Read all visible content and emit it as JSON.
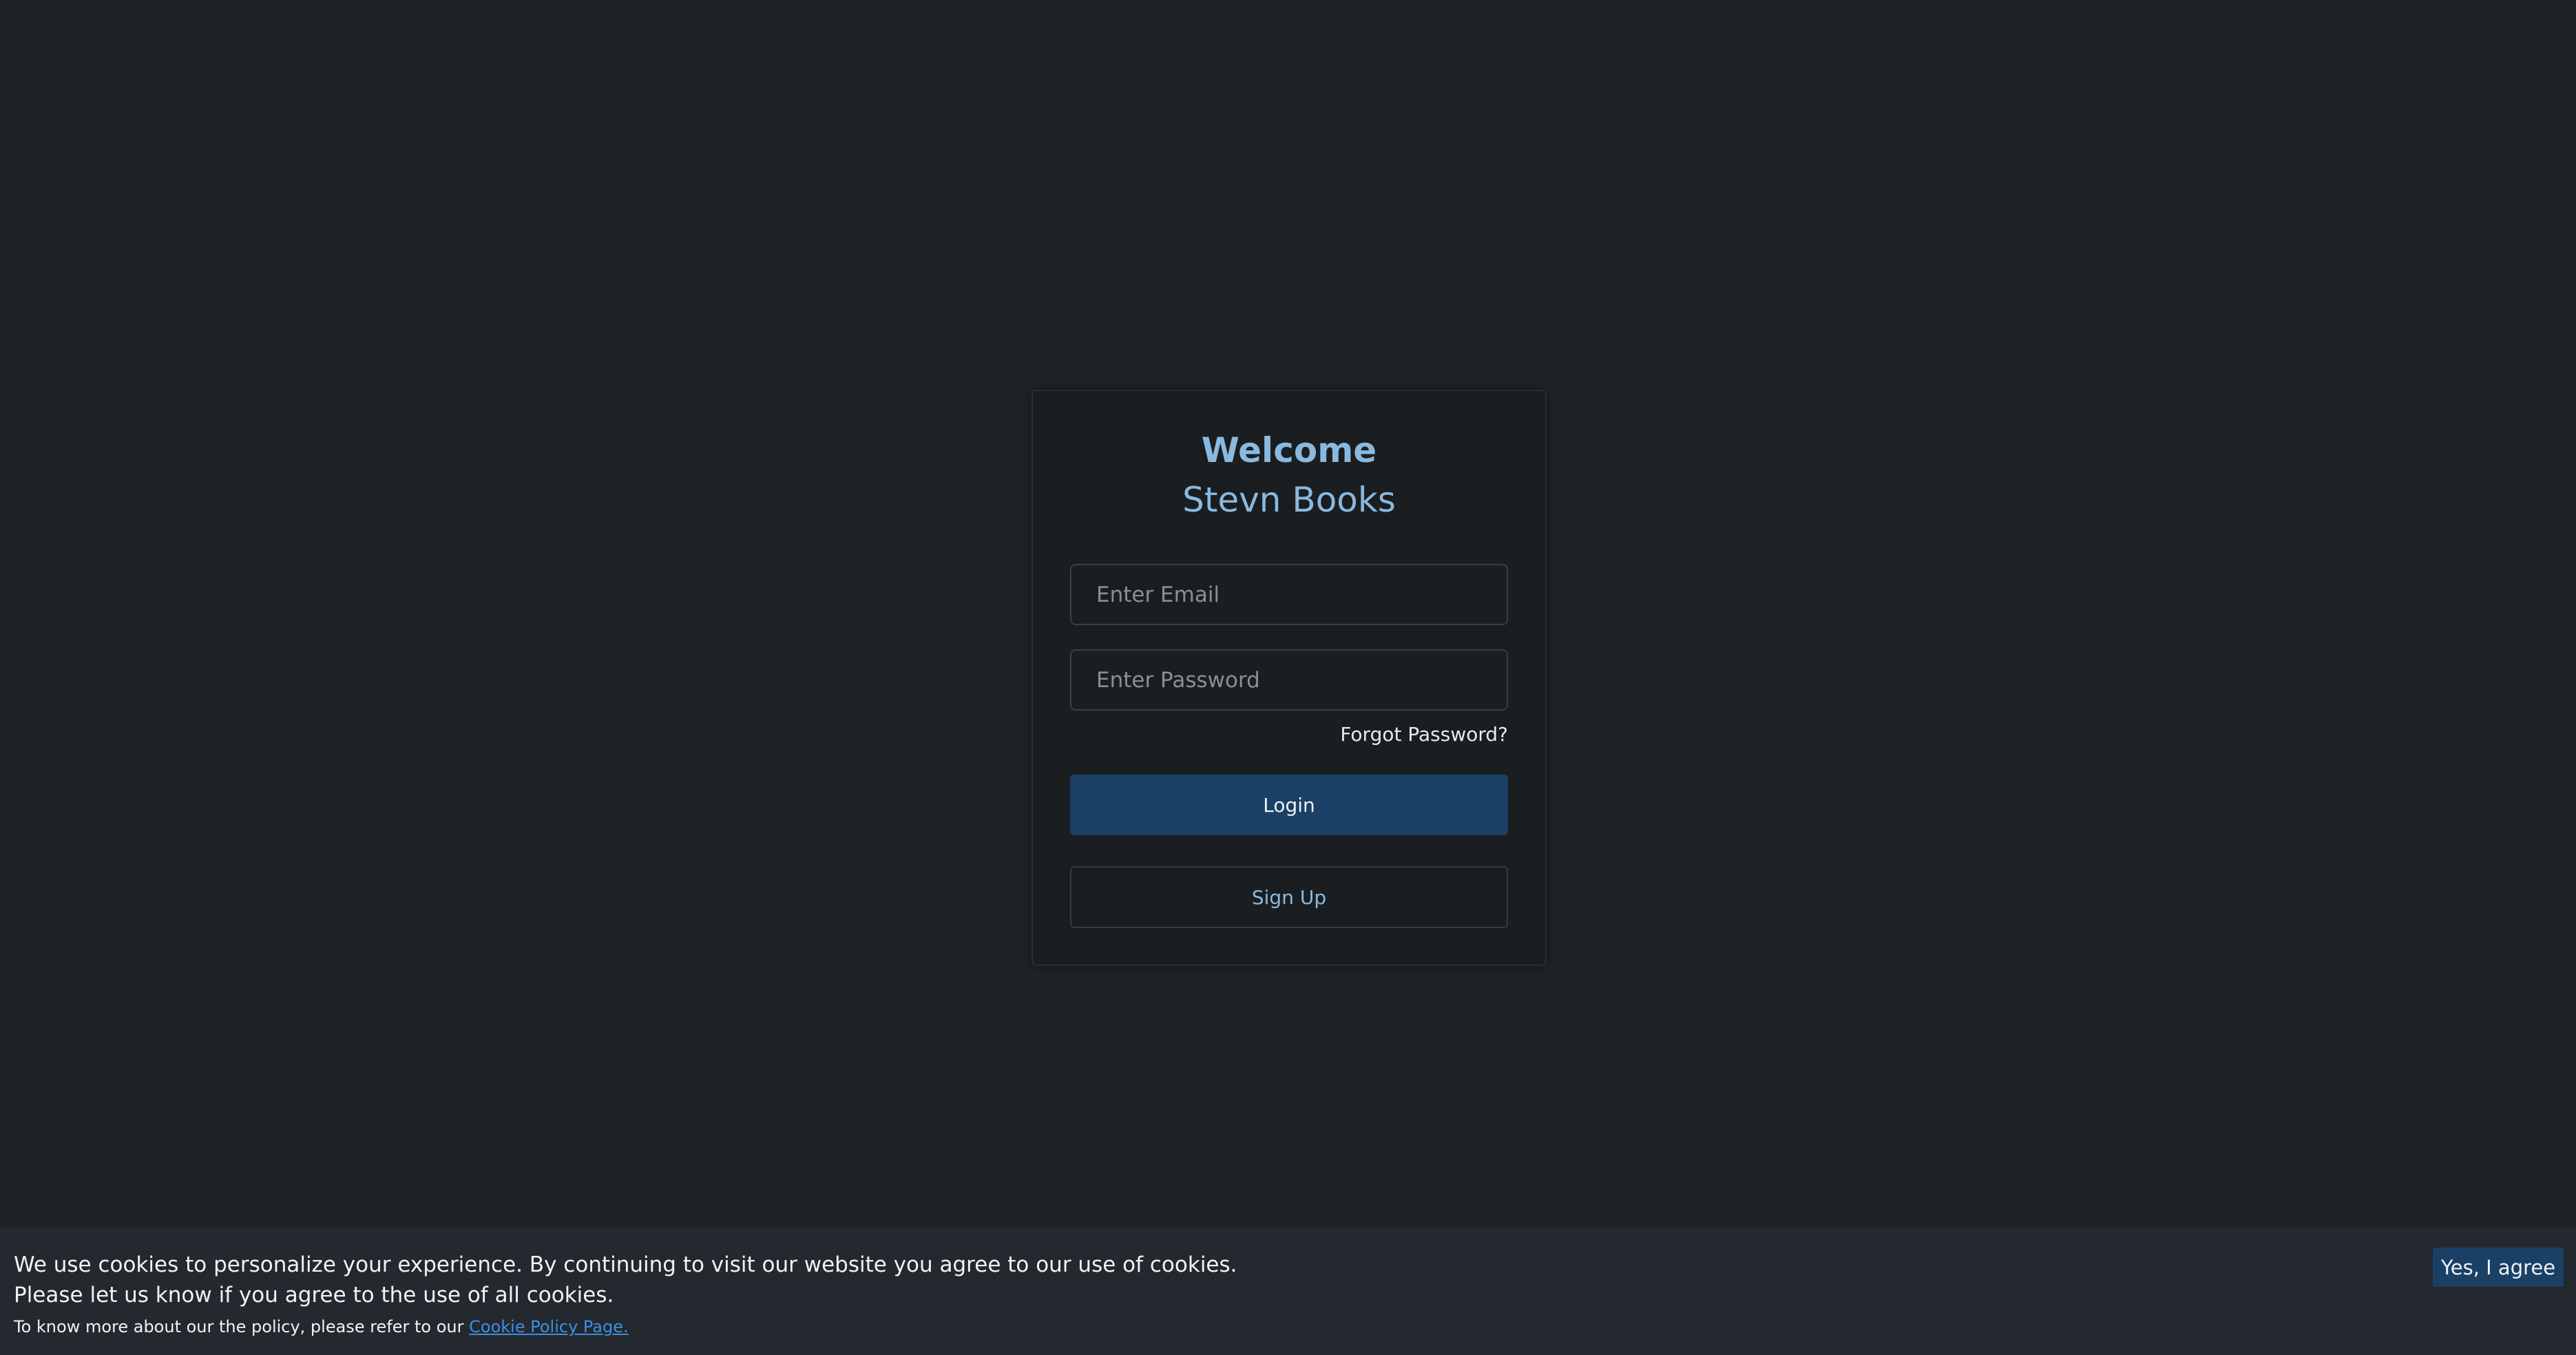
{
  "login": {
    "welcome": "Welcome",
    "brand": "Stevn Books",
    "email_placeholder": "Enter Email",
    "password_placeholder": "Enter Password",
    "forgot_password": "Forgot Password?",
    "login_label": "Login",
    "signup_label": "Sign Up"
  },
  "cookie": {
    "line1": "We use cookies to personalize your experience. By continuing to visit our website you agree to our use of cookies.",
    "line2": "Please let us know if you agree to the use of all cookies.",
    "line3_prefix": "To know more about our the policy, please refer to our",
    "policy_link": "Cookie Policy Page.",
    "agree_label": "Yes, I agree"
  },
  "colors": {
    "background": "#1f2326",
    "card": "#1b1e20",
    "accent": "#8ab9e0",
    "primary_button": "#1b4066",
    "link": "#3d8fe6"
  }
}
